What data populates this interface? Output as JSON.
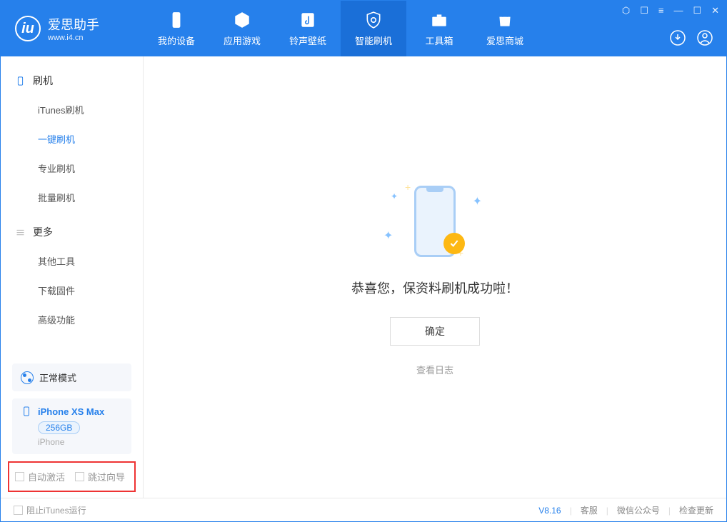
{
  "app": {
    "title": "爱思助手",
    "url": "www.i4.cn"
  },
  "nav": {
    "my_device": "我的设备",
    "apps_games": "应用游戏",
    "ringtones": "铃声壁纸",
    "smart_flash": "智能刷机",
    "toolbox": "工具箱",
    "store": "爱思商城"
  },
  "sidebar": {
    "flash_header": "刷机",
    "items": {
      "itunes": "iTunes刷机",
      "oneclick": "一键刷机",
      "pro": "专业刷机",
      "batch": "批量刷机"
    },
    "more_header": "更多",
    "more": {
      "other_tools": "其他工具",
      "download_fw": "下载固件",
      "advanced": "高级功能"
    }
  },
  "device": {
    "mode_label": "正常模式",
    "name": "iPhone XS Max",
    "storage": "256GB",
    "type": "iPhone"
  },
  "checks": {
    "auto_activate": "自动激活",
    "skip_guide": "跳过向导"
  },
  "main": {
    "success": "恭喜您，保资料刷机成功啦！",
    "ok": "确定",
    "view_log": "查看日志"
  },
  "footer": {
    "block_itunes": "阻止iTunes运行",
    "version": "V8.16",
    "support": "客服",
    "wechat": "微信公众号",
    "check_update": "检查更新"
  }
}
